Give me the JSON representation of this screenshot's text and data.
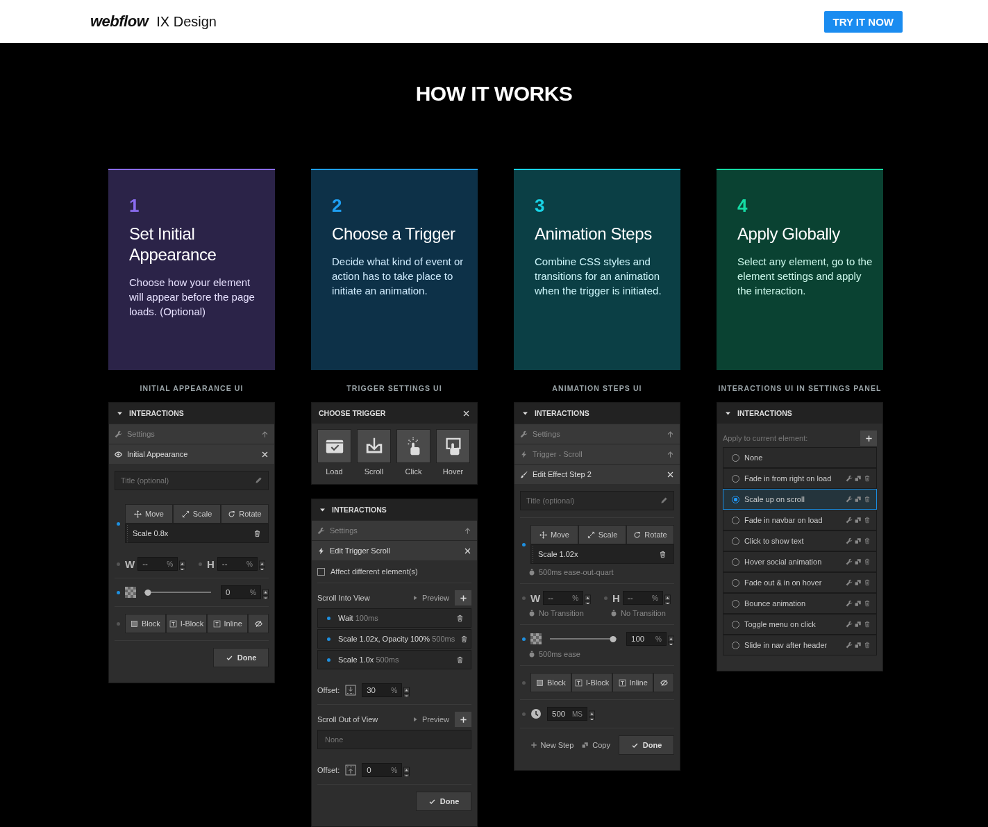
{
  "header": {
    "logo": "webflow",
    "product": "IX Design",
    "cta": "TRY IT NOW"
  },
  "section_title": "HOW IT WORKS",
  "steps": [
    {
      "number": "1",
      "title": "Set Initial Appearance",
      "description": "Choose how your element will appear before the page loads. (Optional)",
      "color": "#8a6cf0"
    },
    {
      "number": "2",
      "title": "Choose a Trigger",
      "description": "Decide what kind of event or action has to take place to initiate an animation.",
      "color": "#1e9ff2"
    },
    {
      "number": "3",
      "title": "Animation Steps",
      "description": "Combine CSS styles and transitions for an animation when the trigger is initiated.",
      "color": "#19d3e6"
    },
    {
      "number": "4",
      "title": "Apply Globally",
      "description": "Select any element, go to the element settings and apply the interaction.",
      "color": "#15dba4"
    }
  ],
  "columns": [
    {
      "caption": "INITIAL APPEARANCE UI",
      "panels": [
        {
          "rows": [
            {
              "kind": "section_header",
              "title": "INTERACTIONS"
            },
            {
              "kind": "settings_row",
              "label": "Settings"
            },
            {
              "kind": "appearance_editor",
              "label": "Initial Appearance"
            },
            {
              "kind": "title_field",
              "placeholder": "Title (optional)"
            },
            {
              "kind": "transforms",
              "active": true,
              "buttons": [
                "Move",
                "Scale",
                "Rotate"
              ],
              "item": "Scale 0.8x"
            },
            {
              "kind": "size",
              "fields": [
                {
                  "letter": "W",
                  "active": false,
                  "value": "--",
                  "unit": "%"
                },
                {
                  "letter": "H",
                  "active": false,
                  "value": "--",
                  "unit": "%"
                }
              ]
            },
            {
              "kind": "opacity",
              "active": true,
              "level": 0,
              "value": "0",
              "unit": "%"
            },
            {
              "kind": "display",
              "active": false,
              "buttons": [
                "Block",
                "I-Block",
                "Inline"
              ]
            },
            {
              "kind": "footer",
              "done": "Done"
            }
          ]
        }
      ]
    },
    {
      "caption": "TRIGGER SETTINGS UI",
      "panels": [
        {
          "rows": [
            {
              "kind": "title_bar",
              "title": "CHOOSE TRIGGER"
            },
            {
              "kind": "triggers",
              "items": [
                "Load",
                "Scroll",
                "Click",
                "Hover"
              ]
            }
          ]
        },
        {
          "rows": [
            {
              "kind": "section_header",
              "title": "INTERACTIONS"
            },
            {
              "kind": "settings_row",
              "label": "Settings"
            },
            {
              "kind": "trigger_editor",
              "label": "Edit Trigger Scroll"
            },
            {
              "kind": "checkbox",
              "label": "Affect different element(s)",
              "checked": false
            },
            {
              "kind": "step_list",
              "title": "Scroll Into View",
              "preview": "Preview",
              "steps": [
                {
                  "action": "Wait",
                  "duration": "100ms",
                  "active": true
                },
                {
                  "action": "Scale 1.02x, Opacity 100%",
                  "duration": "500ms",
                  "active": true
                },
                {
                  "action": "Scale 1.0x",
                  "duration": "500ms",
                  "active": true
                }
              ]
            },
            {
              "kind": "enter_offset",
              "label": "Offset:",
              "value": "30",
              "unit": "%"
            },
            {
              "kind": "step_list",
              "title": "Scroll Out of View",
              "preview": "Preview",
              "empty": "None"
            },
            {
              "kind": "exit_offset",
              "label": "Offset:",
              "value": "0",
              "unit": "%"
            },
            {
              "kind": "footer",
              "done": "Done"
            }
          ]
        }
      ]
    },
    {
      "caption": "ANIMATION STEPS UI",
      "panels": [
        {
          "rows": [
            {
              "kind": "section_header",
              "title": "INTERACTIONS"
            },
            {
              "kind": "settings_row",
              "label": "Settings"
            },
            {
              "kind": "trigger_row",
              "label": "Trigger - Scroll"
            },
            {
              "kind": "step_editor",
              "label": "Edit Effect Step 2"
            },
            {
              "kind": "title_field",
              "placeholder": "Title (optional)"
            },
            {
              "kind": "transforms",
              "active": true,
              "buttons": [
                "Move",
                "Scale",
                "Rotate"
              ],
              "item": "Scale 1.02x",
              "timing": "500ms ease-out-quart"
            },
            {
              "kind": "size",
              "fields": [
                {
                  "letter": "W",
                  "active": false,
                  "value": "--",
                  "unit": "%",
                  "timing": "No Transition"
                },
                {
                  "letter": "H",
                  "active": false,
                  "value": "--",
                  "unit": "%",
                  "timing": "No Transition"
                }
              ]
            },
            {
              "kind": "opacity",
              "active": true,
              "level": 1,
              "value": "100",
              "unit": "%",
              "timing": "500ms ease"
            },
            {
              "kind": "display",
              "active": false,
              "buttons": [
                "Block",
                "I-Block",
                "Inline"
              ]
            },
            {
              "kind": "duration",
              "active": false,
              "value": "500",
              "unit": "MS"
            },
            {
              "kind": "footer",
              "links": [
                "New Step",
                "Copy"
              ],
              "done": "Done"
            }
          ]
        }
      ]
    },
    {
      "caption": "INTERACTIONS UI IN SETTINGS PANEL",
      "panels": [
        {
          "rows": [
            {
              "kind": "section_header",
              "title": "INTERACTIONS"
            },
            {
              "kind": "apply",
              "label": "Apply to current element:",
              "items": [
                {
                  "label": "None",
                  "selected": false,
                  "editable": false
                },
                {
                  "label": "Fade in from right on load",
                  "selected": false,
                  "editable": true
                },
                {
                  "label": "Scale up on scroll",
                  "selected": true,
                  "editable": true
                },
                {
                  "label": "Fade in navbar on load",
                  "selected": false,
                  "editable": true
                },
                {
                  "label": "Click to show text",
                  "selected": false,
                  "editable": true
                },
                {
                  "label": "Hover social animation",
                  "selected": false,
                  "editable": true
                },
                {
                  "label": "Fade out & in on hover",
                  "selected": false,
                  "editable": true
                },
                {
                  "label": "Bounce animation",
                  "selected": false,
                  "editable": true
                },
                {
                  "label": "Toggle menu on click",
                  "selected": false,
                  "editable": true
                },
                {
                  "label": "Slide in nav after header",
                  "selected": false,
                  "editable": true
                }
              ]
            }
          ]
        }
      ]
    }
  ]
}
